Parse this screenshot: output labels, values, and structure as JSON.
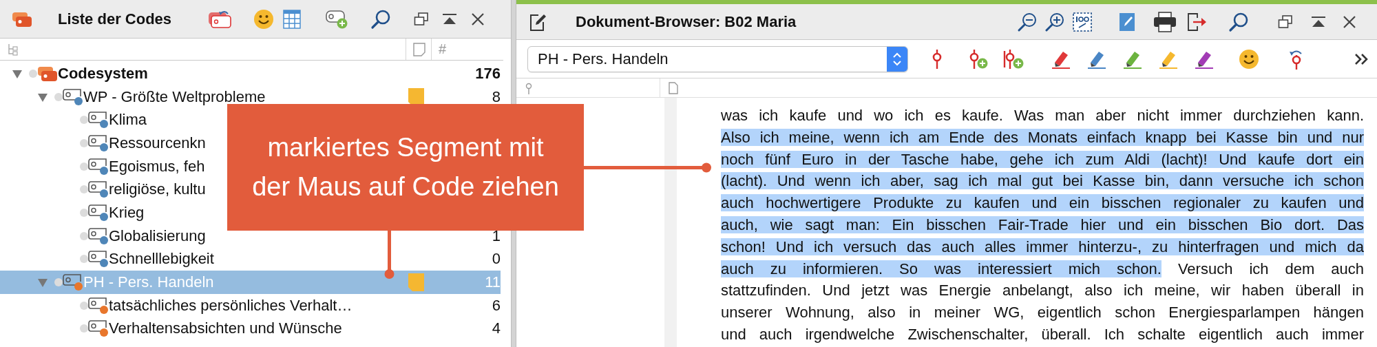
{
  "code_list": {
    "title": "Liste der Codes",
    "count_column_label": "#",
    "codes": [
      {
        "name": "Codesystem",
        "kind": "root",
        "count": "176",
        "expanded": true,
        "selected": false,
        "children": [
          {
            "name": "WP - Größte Weltprobleme",
            "kind": "code",
            "color": "#4f86b8",
            "count": "8",
            "expanded": true,
            "selected": false,
            "memo": true,
            "children": [
              {
                "name": "Klima",
                "kind": "code",
                "color": "#4f86b8",
                "selected": false
              },
              {
                "name": "Ressourcenkn",
                "kind": "code",
                "color": "#4f86b8",
                "selected": false
              },
              {
                "name": "Egoismus, feh",
                "kind": "code",
                "color": "#4f86b8",
                "selected": false
              },
              {
                "name": "religiöse, kultu",
                "kind": "code",
                "color": "#4f86b8",
                "selected": false
              },
              {
                "name": "Krieg",
                "kind": "code",
                "color": "#4f86b8",
                "selected": false
              },
              {
                "name": "Globalisierung",
                "kind": "code",
                "color": "#4f86b8",
                "count": "1",
                "selected": false
              },
              {
                "name": "Schnelllebigkeit",
                "kind": "code",
                "color": "#4f86b8",
                "count": "0",
                "selected": false
              }
            ]
          },
          {
            "name": "PH - Pers. Handeln",
            "kind": "code",
            "color": "#e8762c",
            "count": "11",
            "expanded": true,
            "selected": true,
            "memo": true,
            "children": [
              {
                "name": "tatsächliches persönliches Verhalt…",
                "kind": "code",
                "color": "#e8762c",
                "count": "6",
                "selected": false
              },
              {
                "name": "Verhaltensabsichten und Wünsche",
                "kind": "code",
                "color": "#e8762c",
                "count": "4",
                "selected": false
              }
            ]
          }
        ]
      }
    ]
  },
  "document": {
    "title": "Dokument-Browser: B02 Maria",
    "code_dropdown": {
      "value": "PH - Pers. Handeln"
    },
    "highlighters": [
      {
        "color": "#e0393a"
      },
      {
        "color": "#4a86c5"
      },
      {
        "color": "#6cb33f"
      },
      {
        "color": "#f5b82e"
      },
      {
        "color": "#a23bb5"
      }
    ],
    "lines": [
      {
        "segments": [
          {
            "text": "was ich kaufe und wo ich es kaufe. Was man aber nicht immer durchziehen kann.",
            "highlighted": false
          }
        ]
      },
      {
        "segments": [
          {
            "text": "Also ich meine, wenn ich am Ende des Monats einfach knapp bei Kasse bin und nur",
            "highlighted": true
          }
        ]
      },
      {
        "segments": [
          {
            "text": "noch fünf Euro in der Tasche habe, gehe ich zum Aldi (lacht)! Und kaufe dort ein",
            "highlighted": true
          }
        ]
      },
      {
        "segments": [
          {
            "text": "(lacht). Und wenn ich aber, sag ich mal gut bei Kasse bin, dann versuche ich schon",
            "highlighted": true
          }
        ]
      },
      {
        "segments": [
          {
            "text": "auch hochwertigere Produkte zu kaufen und ein bisschen regionaler zu kaufen und",
            "highlighted": true
          }
        ]
      },
      {
        "segments": [
          {
            "text": "auch, wie sagt man: Ein bisschen Fair-Trade hier und ein bisschen Bio dort. Das",
            "highlighted": true
          }
        ]
      },
      {
        "segments": [
          {
            "text": "schon! Und ich versuch das auch alles immer hinterzu-, zu hinterfragen und mich da",
            "highlighted": true
          }
        ]
      },
      {
        "segments": [
          {
            "text": "auch zu informieren. So was interessiert mich schon.",
            "highlighted": true
          },
          {
            "text": " Versuch ich dem auch",
            "highlighted": false
          }
        ]
      },
      {
        "segments": [
          {
            "text": "stattzufinden. Und jetzt was Energie anbelangt, also ich meine, wir haben überall in",
            "highlighted": false
          }
        ]
      },
      {
        "segments": [
          {
            "text": "unserer Wohnung, also in meiner WG, eigentlich schon Energiesparlampen hängen",
            "highlighted": false
          }
        ]
      },
      {
        "segments": [
          {
            "text": "und auch irgendwelche Zwischenschalter, überall. Ich schalte eigentlich auch immer",
            "highlighted": false
          }
        ]
      }
    ]
  },
  "callout": {
    "lines": [
      "markiertes Segment mit",
      "der Maus auf Code ziehen"
    ]
  }
}
